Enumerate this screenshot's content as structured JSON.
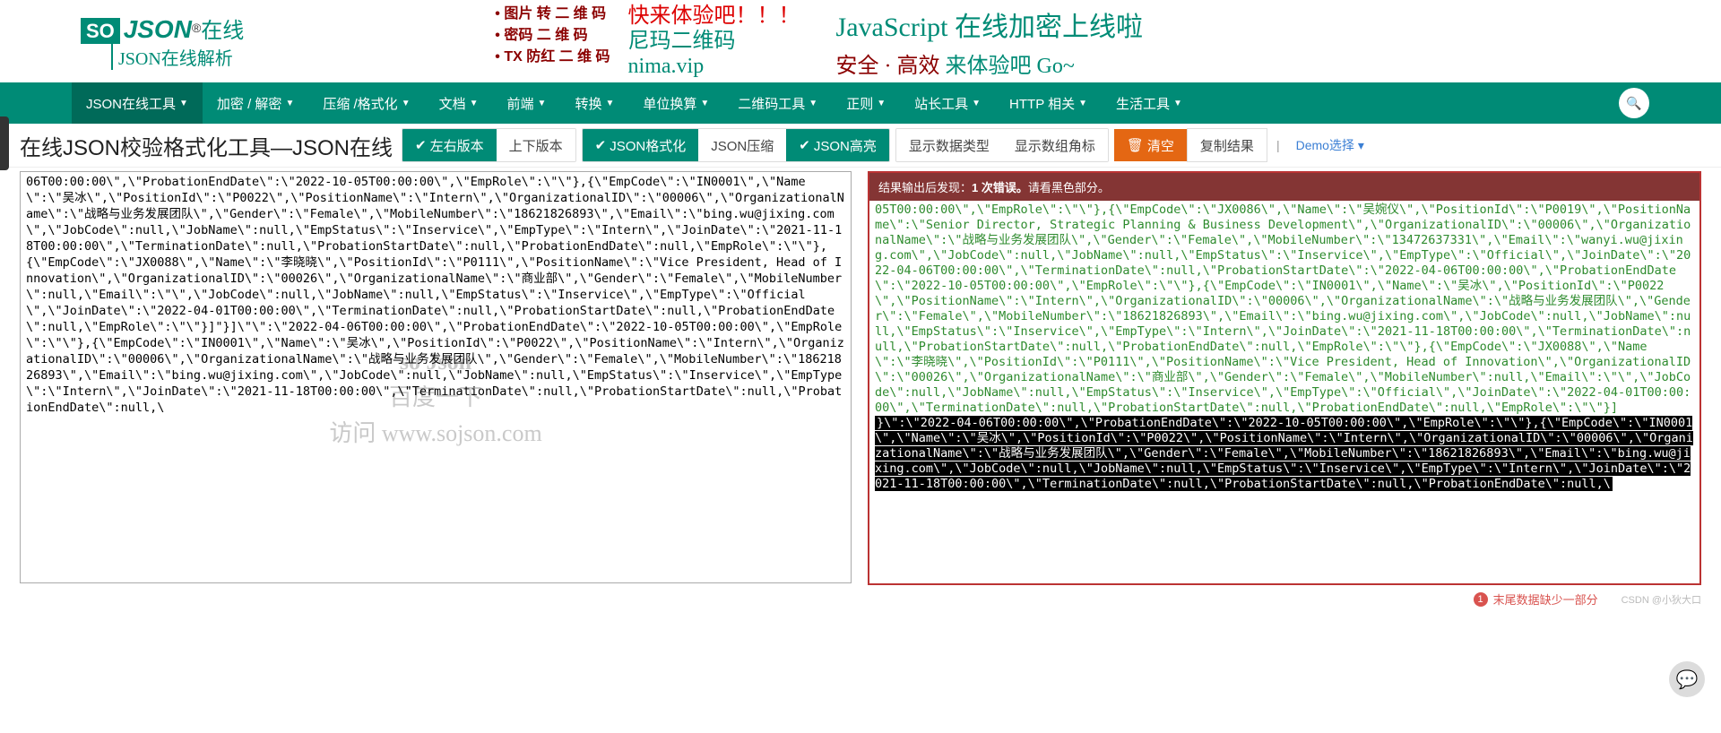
{
  "logo": {
    "box": "SO",
    "json": "JSON",
    "reg": "®",
    "cn": "在线",
    "sub": "JSON在线解析"
  },
  "banner": {
    "bullets": [
      "图片 转 二 维 码",
      "密码 二 维 码",
      "TX 防红 二 维 码"
    ],
    "slogan_l1": "快来体验吧！！！",
    "slogan_l2": "尼玛二维码",
    "slogan_l3": "nima.vip",
    "right_t": "JavaScript 在线加密上线啦",
    "right_s1": "安全 · 高效",
    "right_s2": " 来体验吧 Go~"
  },
  "nav": [
    "JSON在线工具",
    "加密 / 解密",
    "压缩 /格式化",
    "文档",
    "前端",
    "转换",
    "单位换算",
    "二维码工具",
    "正则",
    "站长工具",
    "HTTP 相关",
    "生活工具"
  ],
  "page_title": "在线JSON校验格式化工具—JSON在线",
  "toolbar": {
    "lr": "左右版本",
    "ud": "上下版本",
    "fmt": "JSON格式化",
    "zip": "JSON压缩",
    "hl": "JSON高亮",
    "showtype": "显示数据类型",
    "showbracket": "显示数组角标",
    "clear": "清空",
    "copy": "复制结果",
    "demo": "Demo选择"
  },
  "error_bar": {
    "prefix": "结果输出后发现：",
    "count": "1 次错误。",
    "suffix": "请看黑色部分。"
  },
  "left_text": "06T00:00:00\\\",\\\"ProbationEndDate\\\":\\\"2022-10-05T00:00:00\\\",\\\"EmpRole\\\":\\\"\\\"},{\\\"EmpCode\\\":\\\"IN0001\\\",\\\"Name\\\":\\\"吴冰\\\",\\\"PositionId\\\":\\\"P0022\\\",\\\"PositionName\\\":\\\"Intern\\\",\\\"OrganizationalID\\\":\\\"00006\\\",\\\"OrganizationalName\\\":\\\"战略与业务发展团队\\\",\\\"Gender\\\":\\\"Female\\\",\\\"MobileNumber\\\":\\\"18621826893\\\",\\\"Email\\\":\\\"bing.wu@jixing.com\\\",\\\"JobCode\\\":null,\\\"JobName\\\":null,\\\"EmpStatus\\\":\\\"Inservice\\\",\\\"EmpType\\\":\\\"Intern\\\",\\\"JoinDate\\\":\\\"2021-11-18T00:00:00\\\",\\\"TerminationDate\\\":null,\\\"ProbationStartDate\\\":null,\\\"ProbationEndDate\\\":null,\\\"EmpRole\\\":\\\"\\\"},{\\\"EmpCode\\\":\\\"JX0088\\\",\\\"Name\\\":\\\"李晓晓\\\",\\\"PositionId\\\":\\\"P0111\\\",\\\"PositionName\\\":\\\"Vice President, Head of Innovation\\\",\\\"OrganizationalID\\\":\\\"00026\\\",\\\"OrganizationalName\\\":\\\"商业部\\\",\\\"Gender\\\":\\\"Female\\\",\\\"MobileNumber\\\":null,\\\"Email\\\":\\\"\\\",\\\"JobCode\\\":null,\\\"JobName\\\":null,\\\"EmpStatus\\\":\\\"Inservice\\\",\\\"EmpType\\\":\\\"Official\\\",\\\"JoinDate\\\":\\\"2022-04-01T00:00:00\\\",\\\"TerminationDate\\\":null,\\\"ProbationStartDate\\\":null,\\\"ProbationEndDate\\\":null,\\\"EmpRole\\\":\\\"\\\"}]\"}]\\\"\\\":\\\"2022-04-06T00:00:00\\\",\\\"ProbationEndDate\\\":\\\"2022-10-05T00:00:00\\\",\\\"EmpRole\\\":\\\"\\\"},{\\\"EmpCode\\\":\\\"IN0001\\\",\\\"Name\\\":\\\"吴冰\\\",\\\"PositionId\\\":\\\"P0022\\\",\\\"PositionName\\\":\\\"Intern\\\",\\\"OrganizationalID\\\":\\\"00006\\\",\\\"OrganizationalName\\\":\\\"战略与业务发展团队\\\",\\\"Gender\\\":\\\"Female\\\",\\\"MobileNumber\\\":\\\"18621826893\\\",\\\"Email\\\":\\\"bing.wu@jixing.com\\\",\\\"JobCode\\\":null,\\\"JobName\\\":null,\\\"EmpStatus\\\":\\\"Inservice\\\",\\\"EmpType\\\":\\\"Intern\\\",\\\"JoinDate\\\":\\\"2021-11-18T00:00:00\\\",\\\"TerminationDate\\\":null,\\\"ProbationStartDate\\\":null,\\\"ProbationEndDate\\\":null,\\",
  "right_green": "05T00:00:00\\\",\\\"EmpRole\\\":\\\"\\\"},{\\\"EmpCode\\\":\\\"JX0086\\\",\\\"Name\\\":\\\"吴婉仪\\\",\\\"PositionId\\\":\\\"P0019\\\",\\\"PositionName\\\":\\\"Senior Director, Strategic Planning & Business Development\\\",\\\"OrganizationalID\\\":\\\"00006\\\",\\\"OrganizationalName\\\":\\\"战略与业务发展团队\\\",\\\"Gender\\\":\\\"Female\\\",\\\"MobileNumber\\\":\\\"13472637331\\\",\\\"Email\\\":\\\"wanyi.wu@jixing.com\\\",\\\"JobCode\\\":null,\\\"JobName\\\":null,\\\"EmpStatus\\\":\\\"Inservice\\\",\\\"EmpType\\\":\\\"Official\\\",\\\"JoinDate\\\":\\\"2022-04-06T00:00:00\\\",\\\"TerminationDate\\\":null,\\\"ProbationStartDate\\\":\\\"2022-04-06T00:00:00\\\",\\\"ProbationEndDate\\\":\\\"2022-10-05T00:00:00\\\",\\\"EmpRole\\\":\\\"\\\"},{\\\"EmpCode\\\":\\\"IN0001\\\",\\\"Name\\\":\\\"吴冰\\\",\\\"PositionId\\\":\\\"P0022\\\",\\\"PositionName\\\":\\\"Intern\\\",\\\"OrganizationalID\\\":\\\"00006\\\",\\\"OrganizationalName\\\":\\\"战略与业务发展团队\\\",\\\"Gender\\\":\\\"Female\\\",\\\"MobileNumber\\\":\\\"18621826893\\\",\\\"Email\\\":\\\"bing.wu@jixing.com\\\",\\\"JobCode\\\":null,\\\"JobName\\\":null,\\\"EmpStatus\\\":\\\"Inservice\\\",\\\"EmpType\\\":\\\"Intern\\\",\\\"JoinDate\\\":\\\"2021-11-18T00:00:00\\\",\\\"TerminationDate\\\":null,\\\"ProbationStartDate\\\":null,\\\"ProbationEndDate\\\":null,\\\"EmpRole\\\":\\\"\\\"},{\\\"EmpCode\\\":\\\"JX0088\\\",\\\"Name\\\":\\\"李晓晓\\\",\\\"PositionId\\\":\\\"P0111\\\",\\\"PositionName\\\":\\\"Vice President, Head of Innovation\\\",\\\"OrganizationalID\\\":\\\"00026\\\",\\\"OrganizationalName\\\":\\\"商业部\\\",\\\"Gender\\\":\\\"Female\\\",\\\"MobileNumber\\\":null,\\\"Email\\\":\\\"\\\",\\\"JobCode\\\":null,\\\"JobName\\\":null,\\\"EmpStatus\\\":\\\"Inservice\\\",\\\"EmpType\\\":\\\"Official\\\",\\\"JoinDate\\\":\\\"2022-04-01T00:00:00\\\",\\\"TerminationDate\\\":null,\\\"ProbationStartDate\\\":null,\\\"ProbationEndDate\\\":null,\\\"EmpRole\\\":\\\"\\\"}]",
  "right_black": "}\\\":\\\"2022-04-06T00:00:00\\\",\\\"ProbationEndDate\\\":\\\"2022-10-05T00:00:00\\\",\\\"EmpRole\\\":\\\"\\\"},{\\\"EmpCode\\\":\\\"IN0001\\\",\\\"Name\\\":\\\"吴冰\\\",\\\"PositionId\\\":\\\"P0022\\\",\\\"PositionName\\\":\\\"Intern\\\",\\\"OrganizationalID\\\":\\\"00006\\\",\\\"OrganizationalName\\\":\\\"战略与业务发展团队\\\",\\\"Gender\\\":\\\"Female\\\",\\\"MobileNumber\\\":\\\"18621826893\\\",\\\"Email\\\":\\\"bing.wu@jixing.com\\\",\\\"JobCode\\\":null,\\\"JobName\\\":null,\\\"EmpStatus\\\":\\\"Inservice\\\",\\\"EmpType\\\":\\\"Intern\\\",\\\"JoinDate\\\":\\\"2021-11-18T00:00:00\\\",\\\"TerminationDate\\\":null,\\\"ProbationStartDate\\\":null,\\\"ProbationEndDate\\\":null,\\",
  "watermark": {
    "l1": "so Json",
    "l2": "百度一下",
    "l3": "访问   www.sojson.com"
  },
  "footer": {
    "badge": "1",
    "msg": "末尾数据缺少一部分",
    "csdn": "CSDN @小狄大口"
  }
}
